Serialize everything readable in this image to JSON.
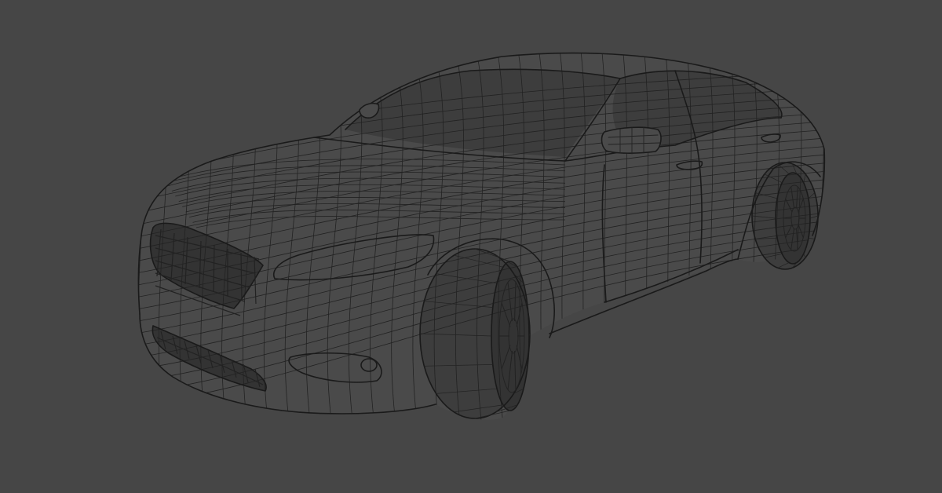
{
  "viewport": {
    "background_color": "#464646",
    "wire_color": "#222222",
    "shading": "wireframe",
    "object": "sedan car mesh"
  }
}
